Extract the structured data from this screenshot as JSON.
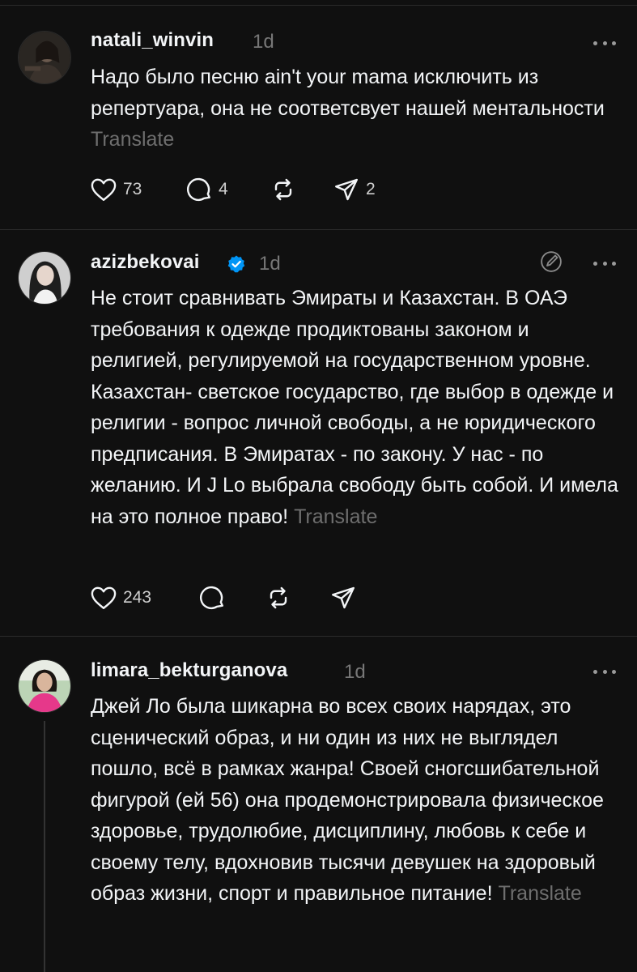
{
  "posts": [
    {
      "username": "natali_winvin",
      "time": "1d",
      "verified": false,
      "text": "Надо было песню ain't your mama исключить из репертуара, она не соответсвует нашей ментальности",
      "translate": "Translate",
      "likes": "73",
      "replies": "4",
      "shares": "2"
    },
    {
      "username": "azizbekovai",
      "time": "1d",
      "verified": true,
      "text": "Не стоит сравнивать Эмираты и Казахстан. В ОАЭ требования к одежде продиктованы законом и религией, регулируемой на государственном уровне. Казахстан- светское государство, где выбор в одежде и религии - вопрос личной свободы, а не юридического предписания. В Эмиратах - по закону. У нас - по желанию. И J Lo выбрала свободу быть собой. И имела на это полное право!",
      "translate": "Translate",
      "likes": "243"
    },
    {
      "username": "limara_bekturganova",
      "time": "1d",
      "verified": false,
      "text": "Джей Ло была шикарна во всех своих нарядах, это сценический образ, и ни один из них не выглядел пошло, всё в рамках жанра! Своей сногсшибательной фигурой (ей 56) она продемонстрировала физическое здоровье, трудолюбие, дисциплину, любовь к себе и своему телу, вдохновив тысячи девушек на здоровый образ жизни, спорт и правильное питание!",
      "translate": "Translate"
    }
  ],
  "colors": {
    "background": "#101010",
    "text": "#f3f5f7",
    "muted": "#777777",
    "verified": "#0095f6"
  }
}
